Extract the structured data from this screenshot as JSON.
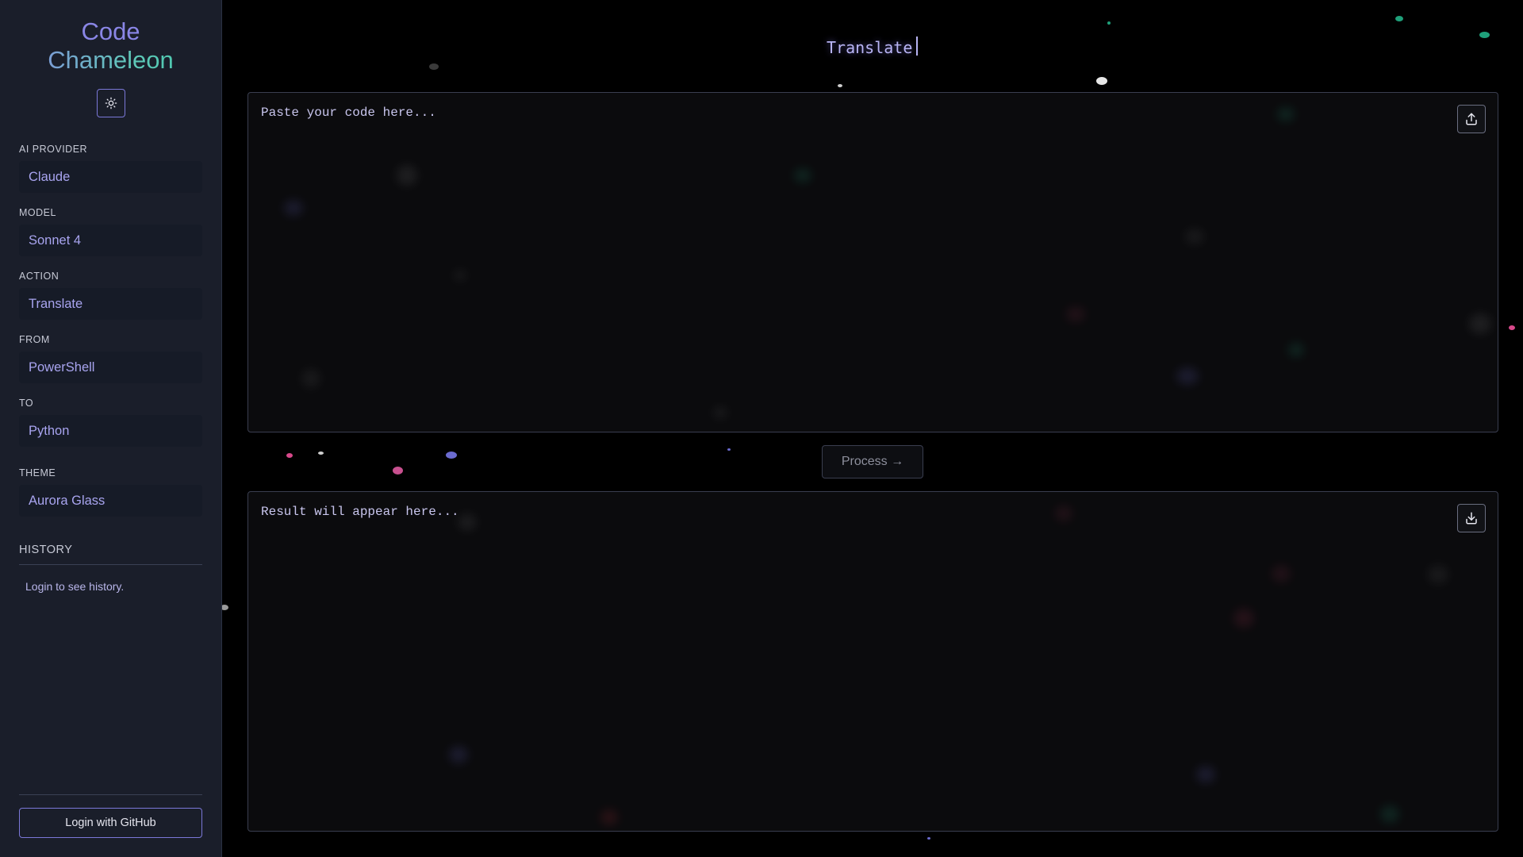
{
  "app": {
    "brand_line1": "Code",
    "brand_line2": "Chameleon"
  },
  "sidebar": {
    "theme_toggle_icon": "sun-icon",
    "fields": [
      {
        "label": "AI PROVIDER",
        "value": "Claude"
      },
      {
        "label": "MODEL",
        "value": "Sonnet 4"
      },
      {
        "label": "ACTION",
        "value": "Translate"
      },
      {
        "label": "FROM",
        "value": "PowerShell"
      },
      {
        "label": "TO",
        "value": "Python"
      },
      {
        "label": "THEME",
        "value": "Aurora Glass"
      }
    ],
    "history_title": "HISTORY",
    "history_message": "Login to see history.",
    "login_button": "Login with GitHub"
  },
  "main": {
    "title": "Translate",
    "input_placeholder": "Paste your code here...",
    "upload_icon": "upload-icon",
    "process_button": "Process →",
    "output_placeholder": "Result will appear here...",
    "download_icon": "download-icon"
  },
  "colors": {
    "background": "#000000",
    "sidebar": "#1a1e2a",
    "accent": "#8a86e6",
    "teal": "#3ec7a8"
  }
}
